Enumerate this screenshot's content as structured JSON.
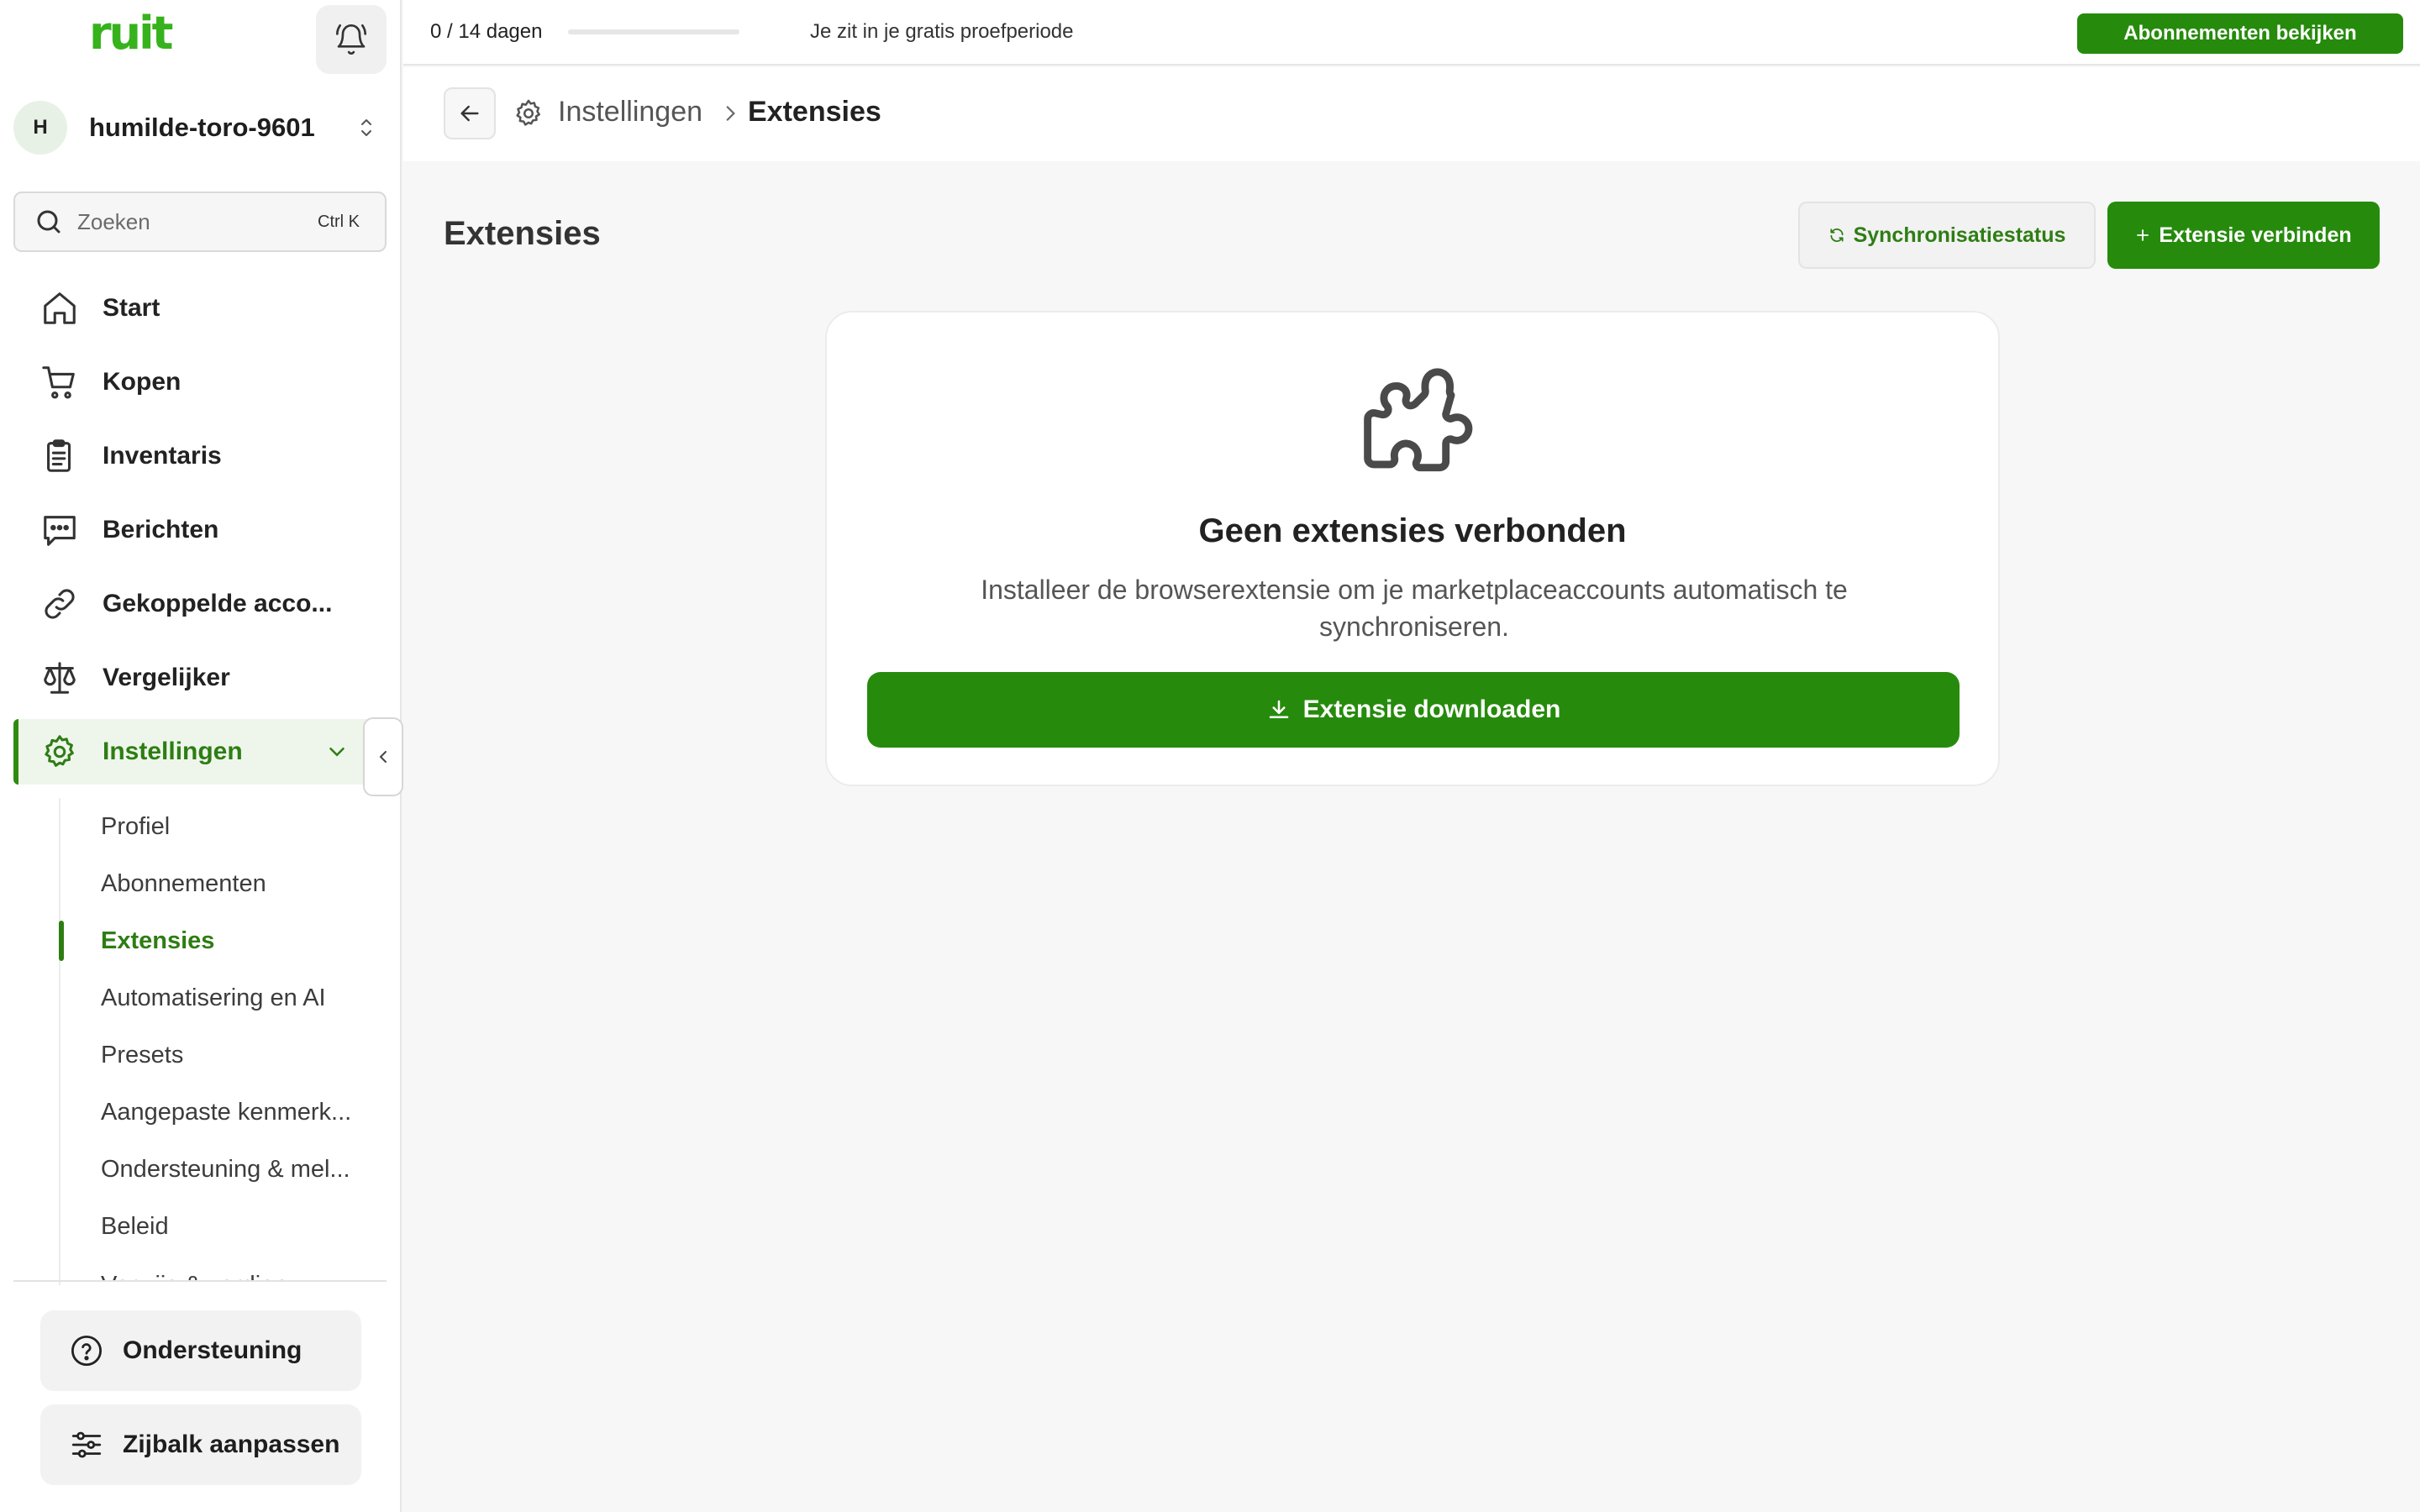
{
  "brand": {
    "logo_text": "ruit"
  },
  "workspace": {
    "avatar_initial": "H",
    "name": "humilde-toro-9601"
  },
  "search": {
    "placeholder": "Zoeken",
    "shortcut": "Ctrl K"
  },
  "sidebar": {
    "items": [
      {
        "label": "Start",
        "icon": "home-icon"
      },
      {
        "label": "Kopen",
        "icon": "cart-icon"
      },
      {
        "label": "Inventaris",
        "icon": "clipboard-icon"
      },
      {
        "label": "Berichten",
        "icon": "chat-icon"
      },
      {
        "label": "Gekoppelde acco...",
        "icon": "link-icon"
      },
      {
        "label": "Vergelijker",
        "icon": "scale-icon"
      },
      {
        "label": "Instellingen",
        "icon": "gear-icon",
        "active": true
      }
    ],
    "settings_sub": [
      "Profiel",
      "Abonnementen",
      "Extensies",
      "Automatisering en AI",
      "Presets",
      "Aangepaste kenmerk...",
      "Ondersteuning & mel...",
      "Beleid",
      "Verwijs & verdien"
    ],
    "active_sub": "Extensies",
    "footer": {
      "support_label": "Ondersteuning",
      "customize_label": "Zijbalk aanpassen"
    }
  },
  "topbar": {
    "trial_count": "0 / 14 dagen",
    "trial_progress": 0,
    "trial_text": "Je zit in je gratis proefperiode",
    "cta_label": "Abonnementen bekijken"
  },
  "breadcrumb": {
    "parent": "Instellingen",
    "current": "Extensies"
  },
  "main": {
    "title": "Extensies",
    "sync_label": "Synchronisatiestatus",
    "connect_label": "Extensie verbinden",
    "empty": {
      "title": "Geen extensies verbonden",
      "text": "Installeer de browserextensie om je marketplaceaccounts automatisch te synchroniseren.",
      "download_label": "Extensie downloaden"
    }
  },
  "colors": {
    "accent": "#268b0c",
    "logo": "#36b31c",
    "active_bg": "#eef6ec"
  }
}
